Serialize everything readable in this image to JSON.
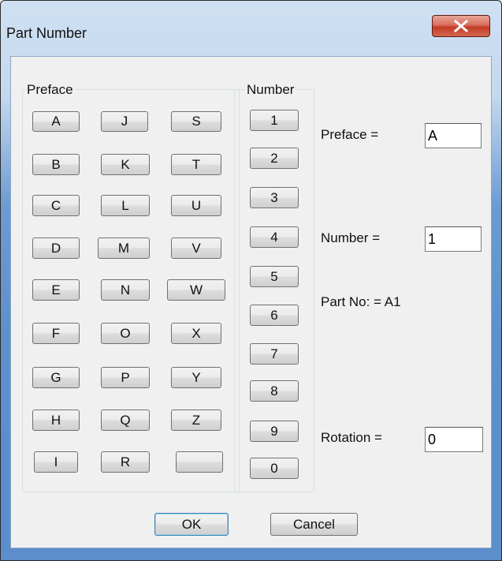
{
  "window": {
    "title": "Part Number",
    "close_glyph": "X"
  },
  "preface_group": {
    "label": "Preface",
    "buttons": [
      "A",
      "J",
      "S",
      "B",
      "K",
      "T",
      "C",
      "L",
      "U",
      "D",
      "M",
      "V",
      "E",
      "N",
      "W",
      "F",
      "O",
      "X",
      "G",
      "P",
      "Y",
      "H",
      "Q",
      "Z",
      "I",
      "R",
      ""
    ]
  },
  "number_group": {
    "label": "Number",
    "buttons": [
      "1",
      "2",
      "3",
      "4",
      "5",
      "6",
      "7",
      "8",
      "9",
      "0"
    ]
  },
  "fields": {
    "preface": {
      "label": "Preface =",
      "value": "A"
    },
    "number": {
      "label": "Number =",
      "value": "1"
    },
    "rotation": {
      "label": "Rotation =",
      "value": "0"
    }
  },
  "part_no": {
    "text": "Part No: = A1"
  },
  "actions": {
    "ok": "OK",
    "cancel": "Cancel"
  }
}
